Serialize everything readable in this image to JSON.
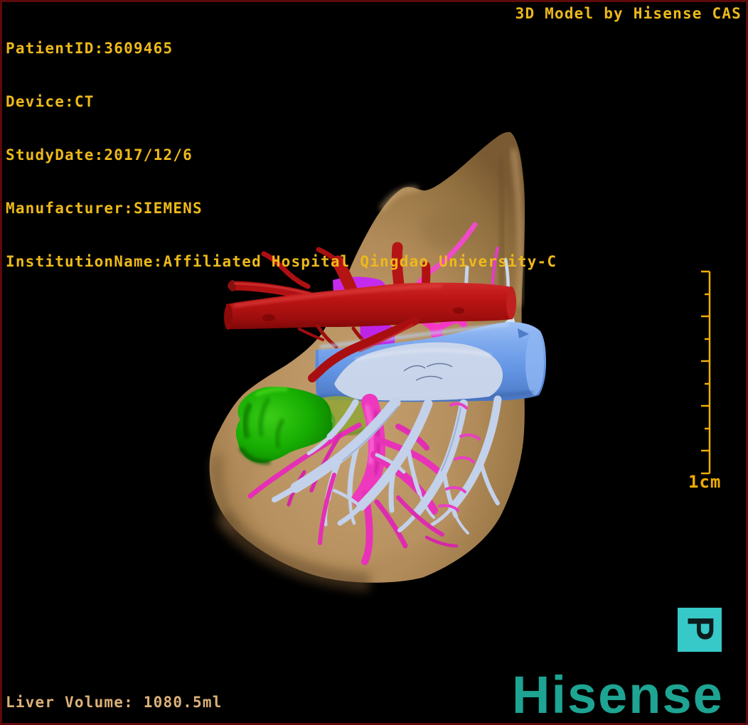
{
  "overlay": {
    "patient_info": [
      "PatientID:3609465",
      "Device:CT",
      "StudyDate:2017/12/6",
      "Manufacturer:SIEMENS",
      "InstitutionName:Affiliated Hospital Qingdao University-C"
    ],
    "watermark": "3D Model by Hisense CAS",
    "liver_volume": "Liver Volume: 1080.5ml"
  },
  "scale_bar": {
    "label": "1cm",
    "tick_count": 10
  },
  "orientation_marker": {
    "label": "P"
  },
  "brand": {
    "wordmark": "Hisense"
  },
  "model": {
    "structures": [
      {
        "name": "liver",
        "color": "#b8905c"
      },
      {
        "name": "hepatic-artery",
        "color": "#b41212"
      },
      {
        "name": "inferior-vena-cava",
        "color": "#6fa0ea"
      },
      {
        "name": "portal-vein",
        "color": "#ee38be"
      },
      {
        "name": "hepatic-veins",
        "color": "#c3d1eb"
      },
      {
        "name": "gallbladder",
        "color": "#17ae02"
      },
      {
        "name": "accessory-vessel",
        "color": "#c52bee"
      }
    ]
  },
  "colors": {
    "background": "#000000",
    "border_color": "#5c0a0b",
    "overlay_text": "#edb91a",
    "footer_text": "#dcb178",
    "scale_color": "#f0ad00",
    "brand_teal": "#1ea492",
    "marker_bg": "#36c9c8",
    "marker_glyph": "#0c1c1c"
  }
}
